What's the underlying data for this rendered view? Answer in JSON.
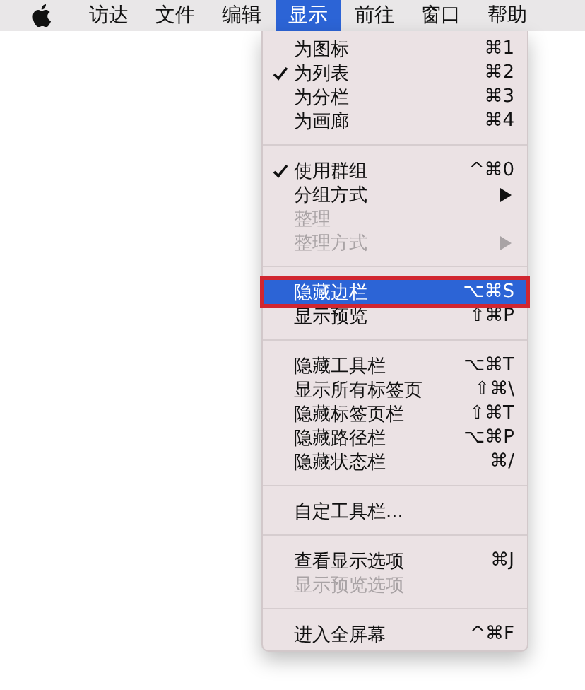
{
  "menu_bar": {
    "items": [
      {
        "label": "访达",
        "selected": false
      },
      {
        "label": "文件",
        "selected": false
      },
      {
        "label": "编辑",
        "selected": false
      },
      {
        "label": "显示",
        "selected": true
      },
      {
        "label": "前往",
        "selected": false
      },
      {
        "label": "窗口",
        "selected": false
      },
      {
        "label": "帮助",
        "selected": false
      }
    ]
  },
  "menu": {
    "groups": [
      {
        "items": [
          {
            "label": "为图标",
            "shortcut": "⌘1",
            "checked": false,
            "disabled": false,
            "selected": false
          },
          {
            "label": "为列表",
            "shortcut": "⌘2",
            "checked": true,
            "disabled": false,
            "selected": false
          },
          {
            "label": "为分栏",
            "shortcut": "⌘3",
            "checked": false,
            "disabled": false,
            "selected": false
          },
          {
            "label": "为画廊",
            "shortcut": "⌘4",
            "checked": false,
            "disabled": false,
            "selected": false
          }
        ]
      },
      {
        "items": [
          {
            "label": "使用群组",
            "shortcut": "^⌘0",
            "checked": true,
            "disabled": false,
            "selected": false
          },
          {
            "label": "分组方式",
            "submenu": true,
            "checked": false,
            "disabled": false,
            "selected": false
          },
          {
            "label": "整理",
            "checked": false,
            "disabled": true,
            "selected": false
          },
          {
            "label": "整理方式",
            "submenu": true,
            "checked": false,
            "disabled": true,
            "selected": false
          }
        ]
      },
      {
        "items": [
          {
            "label": "隐藏边栏",
            "shortcut": "⌥⌘S",
            "checked": false,
            "disabled": false,
            "selected": true,
            "outlined": true
          },
          {
            "label": "显示预览",
            "shortcut": "⇧⌘P",
            "checked": false,
            "disabled": false,
            "selected": false
          }
        ]
      },
      {
        "items": [
          {
            "label": "隐藏工具栏",
            "shortcut": "⌥⌘T",
            "checked": false,
            "disabled": false,
            "selected": false
          },
          {
            "label": "显示所有标签页",
            "shortcut": "⇧⌘\\",
            "checked": false,
            "disabled": false,
            "selected": false
          },
          {
            "label": "隐藏标签页栏",
            "shortcut": "⇧⌘T",
            "checked": false,
            "disabled": false,
            "selected": false
          },
          {
            "label": "隐藏路径栏",
            "shortcut": "⌥⌘P",
            "checked": false,
            "disabled": false,
            "selected": false
          },
          {
            "label": "隐藏状态栏",
            "shortcut": "⌘/",
            "checked": false,
            "disabled": false,
            "selected": false
          }
        ]
      },
      {
        "items": [
          {
            "label": "自定工具栏...",
            "checked": false,
            "disabled": false,
            "selected": false
          }
        ]
      },
      {
        "items": [
          {
            "label": "查看显示选项",
            "shortcut": "⌘J",
            "checked": false,
            "disabled": false,
            "selected": false
          },
          {
            "label": "显示预览选项",
            "checked": false,
            "disabled": true,
            "selected": false
          }
        ]
      },
      {
        "items": [
          {
            "label": "进入全屏幕",
            "shortcut": "^⌘F",
            "checked": false,
            "disabled": false,
            "selected": false
          }
        ]
      }
    ]
  }
}
